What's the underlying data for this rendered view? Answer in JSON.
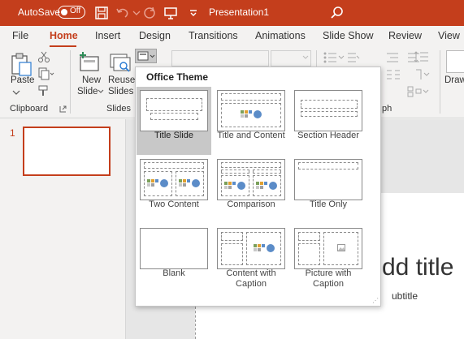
{
  "titlebar": {
    "autosave_label": "AutoSave",
    "toggle_state": "Off",
    "document_title": "Presentation1"
  },
  "tabs": [
    {
      "label": "File"
    },
    {
      "label": "Home"
    },
    {
      "label": "Insert"
    },
    {
      "label": "Design"
    },
    {
      "label": "Transitions"
    },
    {
      "label": "Animations"
    },
    {
      "label": "Slide Show"
    },
    {
      "label": "Review"
    },
    {
      "label": "View"
    }
  ],
  "ribbon": {
    "paste_label": "Paste",
    "new_slide_label_1": "New",
    "new_slide_label_2": "Slide",
    "reuse_slides_label_1": "Reuse",
    "reuse_slides_label_2": "Slides",
    "draw_label": "Draw",
    "group_clipboard": "Clipboard",
    "group_slides": "Slides",
    "group_paragraph_fragment": "ph"
  },
  "slides_pane": {
    "slide_number": "1"
  },
  "canvas": {
    "title_fragment": "dd title",
    "subtitle_fragment": "ubtitle"
  },
  "layout_menu": {
    "heading": "Office Theme",
    "layouts": [
      {
        "name": "Title Slide"
      },
      {
        "name": "Title and Content"
      },
      {
        "name": "Section Header"
      },
      {
        "name": "Two Content"
      },
      {
        "name": "Comparison"
      },
      {
        "name": "Title Only"
      },
      {
        "name": "Blank"
      },
      {
        "name": "Content with Caption"
      },
      {
        "name": "Picture with Caption"
      }
    ]
  },
  "colors": {
    "accent": "#c43e1c",
    "ribbon_bg": "#f3f2f1"
  }
}
